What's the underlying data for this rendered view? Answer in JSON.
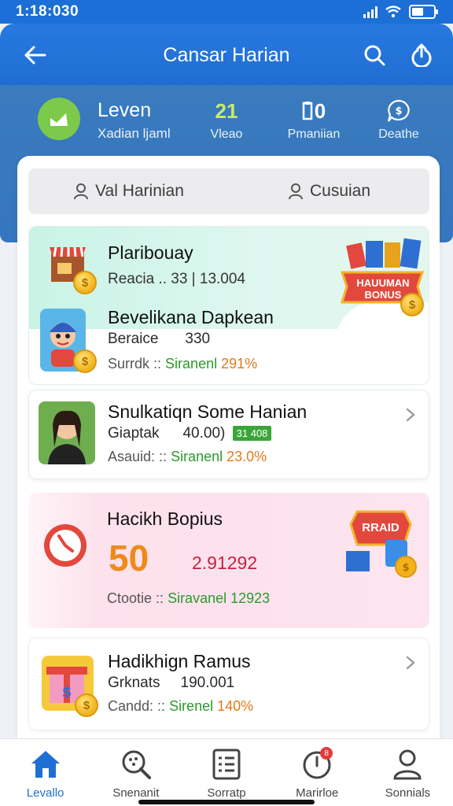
{
  "status": {
    "time": "1:18:030"
  },
  "app_bar": {
    "title": "Cansar Harian"
  },
  "stats": {
    "level_name": "Leven",
    "level_sub": "Xadian ljaml",
    "items": [
      {
        "value": "21",
        "label": "Vleao"
      },
      {
        "value": "0",
        "label": "Pmaniian"
      },
      {
        "value": "",
        "label": "Deathe"
      }
    ]
  },
  "segment": {
    "left_label": "Val Harinian",
    "right_label": "Cusuian"
  },
  "cards": [
    {
      "title": "Plaribouay",
      "meta_left": "Reacia .. 33 | 13.004",
      "sub_title": "Bevelikana Dapkean",
      "sub_meta_a": "Beraice",
      "sub_meta_b": "330",
      "stat_left": "Surrdk ::",
      "stat_mid": "Siranenl",
      "stat_val": "291%",
      "banner_text": "HAUUMAN BONUS"
    },
    {
      "title": "Snulkatiqn Some Hanian",
      "meta_a": "Giaptak",
      "meta_b": "40.00)",
      "tag": "31 408",
      "stat_left": "Asauid: ::",
      "stat_mid": "Siranenl",
      "stat_val": "23.0%"
    },
    {
      "title": "Hacikh Bopius",
      "big_value": "50",
      "big_code": "2.91292",
      "stat_left": "Ctootie ::",
      "stat_mid": "Siravanel",
      "stat_val": "12923",
      "banner_text": "RRAID"
    },
    {
      "title": "Hadikhign Ramus",
      "meta_a": "Grknats",
      "meta_b": "190.001",
      "stat_left": "Candd: ::",
      "stat_mid": "Sirenel",
      "stat_val": "140%"
    }
  ],
  "bottom_nav": [
    {
      "label": "Levallo",
      "icon": "home-icon"
    },
    {
      "label": "Snenanit",
      "icon": "search-icon"
    },
    {
      "label": "Sorratp",
      "icon": "list-icon"
    },
    {
      "label": "Marirloe",
      "icon": "clock-icon",
      "badge": "8"
    },
    {
      "label": "Sonnials",
      "icon": "person-icon"
    }
  ],
  "colors": {
    "primary": "#1e6fd3",
    "accent_green": "#2a9a2a",
    "accent_orange": "#e07a1c",
    "card_mint": "#d9f6ef",
    "card_pink": "#fde4ef"
  }
}
